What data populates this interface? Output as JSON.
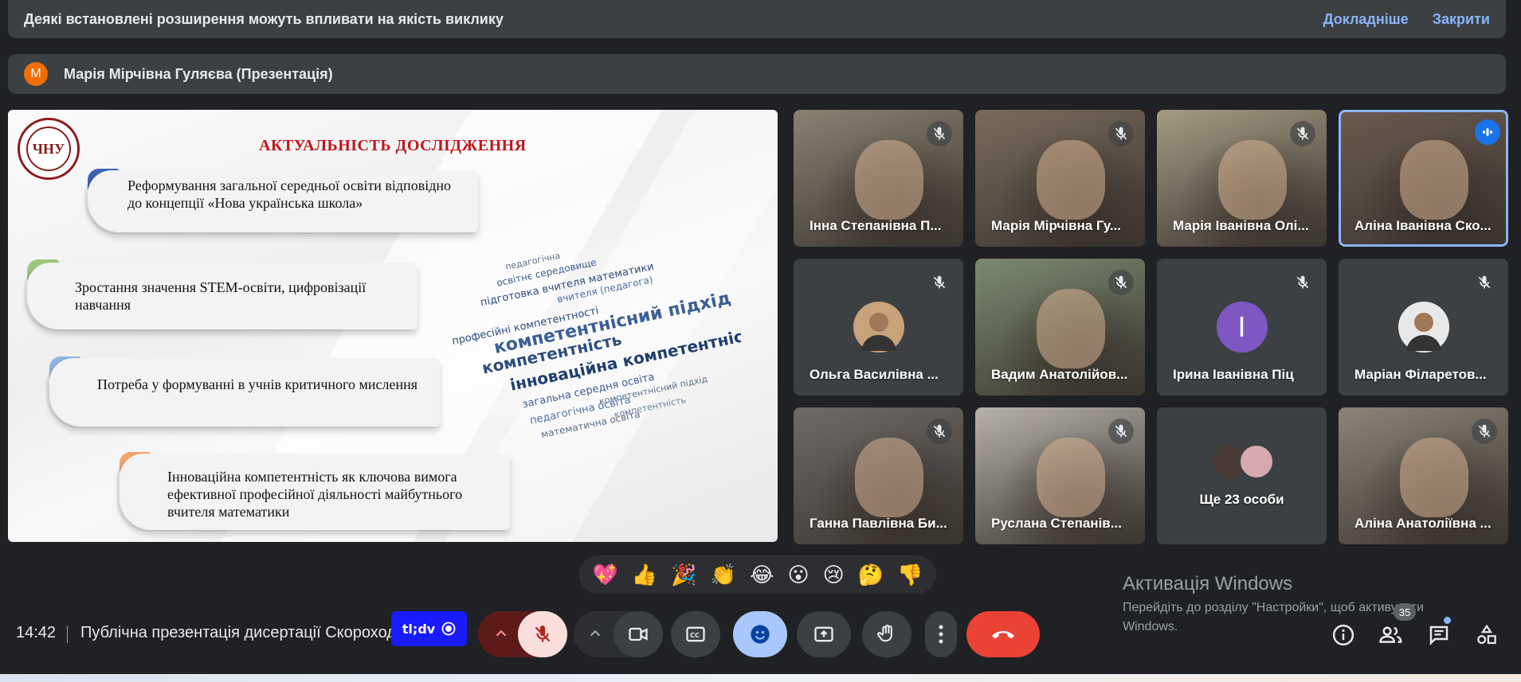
{
  "banner": {
    "message": "Деякі встановлені розширення можуть впливати на якість виклику",
    "details_link": "Докладніше",
    "close_link": "Закрити"
  },
  "presenter": {
    "avatar_letter": "M",
    "avatar_color": "#f06d06",
    "label": "Марія Мірчівна Гуляєва (Презентація)"
  },
  "slide": {
    "logo_text": "ЧНУ",
    "title": "АКТУАЛЬНІСТЬ ДОСЛІДЖЕННЯ",
    "points": [
      {
        "text": "Реформування загальної середньої освіти відповідно до концепції «Нова українська школа»",
        "color": "#3d63b8"
      },
      {
        "text": "Зростання значення STEM-освіти, цифровізації навчання",
        "color": "#9cc77b"
      },
      {
        "text": "Потреба у формуванні в учнів критичного мислення",
        "color": "#8db4e2"
      },
      {
        "text": "Інноваційна компетентність як ключова вимога ефективної професійної діяльності майбутнього вчителя математики",
        "color": "#f2a46f"
      }
    ],
    "wordcloud_words": [
      "педагогічна",
      "освітнє середовище",
      "підготовка вчителя математики",
      "вчителя (педагога)",
      "професійні компетентності",
      "компетентнісний підхід",
      "компетентність",
      "інноваційна компетентність",
      "загальна середня освіта",
      "педагогічна освіта",
      "математична освіта",
      "компетентнісний підхід",
      "компетентність"
    ]
  },
  "participants": [
    {
      "name": "Інна Степанівна П...",
      "type": "video",
      "muted": true,
      "bg": "#8a8170"
    },
    {
      "name": "Марія Мірчівна Гу...",
      "type": "video",
      "muted": true,
      "bg": "#7a6b5a"
    },
    {
      "name": "Марія Іванівна Олі...",
      "type": "video",
      "muted": true,
      "bg": "#a69b83"
    },
    {
      "name": "Аліна Іванівна Ско...",
      "type": "video",
      "muted": false,
      "speaking": true,
      "bg": "#6b5a4f"
    },
    {
      "name": "Ольга Василівна ...",
      "type": "photo",
      "muted": true,
      "avatar_bg": "#c8a27a"
    },
    {
      "name": "Вадим Анатолійов...",
      "type": "video",
      "muted": true,
      "bg": "#7c8a6e"
    },
    {
      "name": "Ірина Іванівна Піц",
      "type": "letter",
      "muted": true,
      "letter": "I",
      "avatar_bg": "#7e57c2"
    },
    {
      "name": "Маріан Філаретов...",
      "type": "photo",
      "muted": true,
      "avatar_bg": "#e8e8e8"
    },
    {
      "name": "Ганна Павлівна Би...",
      "type": "video",
      "muted": true,
      "bg": "#6e6a66"
    },
    {
      "name": "Руслана Степанів...",
      "type": "video",
      "muted": true,
      "bg": "#b7b2aa"
    },
    {
      "name": "Ще 23 особи",
      "type": "more",
      "muted": false
    },
    {
      "name": "Аліна Анатоліївна ...",
      "type": "video",
      "muted": true,
      "bg": "#8b8477"
    }
  ],
  "reactions": [
    "💖",
    "👍",
    "🎉",
    "👏",
    "😂",
    "😮",
    "😢",
    "🤔",
    "👎"
  ],
  "bottom": {
    "time": "14:42",
    "meeting_title": "Публічна презентація дисертації Скорохода",
    "extension_badge": "tl;dv",
    "people_count": "35",
    "accent_blue": "#8ab4f8",
    "end_call_color": "#ea4335"
  },
  "windows_activation": {
    "title": "Активація Windows",
    "subtitle": "Перейдіть до розділу \"Настройки\", щоб активувати Windows."
  }
}
